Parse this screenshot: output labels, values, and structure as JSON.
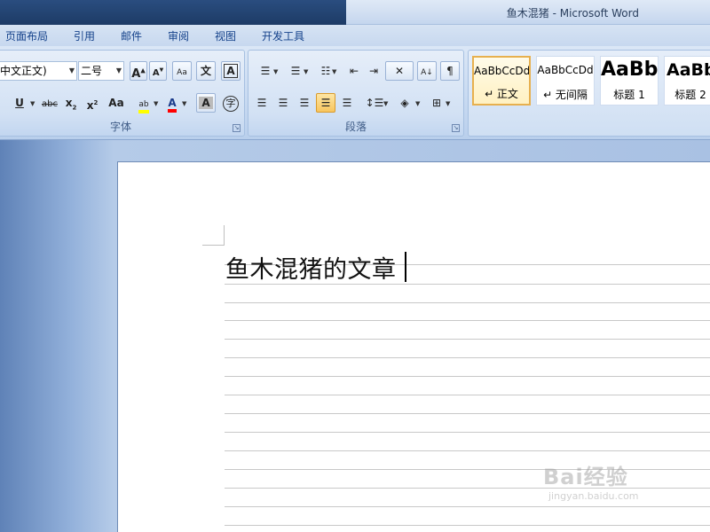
{
  "window": {
    "title": "鱼木混猪 - Microsoft Word"
  },
  "tabs": [
    "页面布局",
    "引用",
    "邮件",
    "审阅",
    "视图",
    "开发工具"
  ],
  "font_group": {
    "font_name": "中文正文)",
    "font_size": "二号",
    "label": "字体",
    "wen_char": "文",
    "zi_char": "字",
    "abc_label": "abc",
    "aa_label": "Aa"
  },
  "paragraph_group": {
    "label": "段落"
  },
  "styles": [
    {
      "sample": "AaBbCcDd",
      "name": "↵ 正文",
      "selected": true
    },
    {
      "sample": "AaBbCcDd",
      "name": "↵ 无间隔",
      "selected": false
    },
    {
      "sample": "AaBb",
      "name": "标题 1",
      "selected": false
    },
    {
      "sample": "AaBb",
      "name": "标题 2",
      "selected": false
    }
  ],
  "document": {
    "text": "鱼木混猪的文章"
  },
  "watermark": {
    "main": "Bai经验",
    "sub": "jingyan.baidu.com"
  },
  "colors": {
    "highlight": "#ffff00",
    "font_color": "#ff0000",
    "accent": "#15428b"
  }
}
